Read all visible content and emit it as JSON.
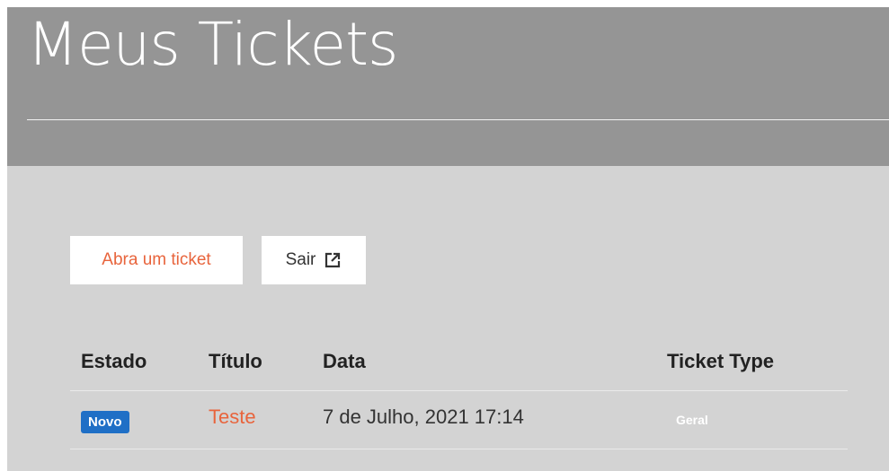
{
  "header": {
    "title": "Meus Tickets"
  },
  "actions": {
    "open_ticket_label": "Abra um ticket",
    "exit_label": "Sair",
    "exit_icon": "external-link-icon"
  },
  "colors": {
    "accent": "#e8643c",
    "status_new": "#1f6fc6",
    "header_bg": "#959595",
    "body_bg": "#d3d3d3"
  },
  "table": {
    "columns": [
      "Estado",
      "Título",
      "Data",
      "Ticket Type"
    ],
    "rows": [
      {
        "status": "Novo",
        "title": "Teste",
        "date": "7 de Julho, 2021 17:14",
        "type": "Geral"
      }
    ]
  }
}
